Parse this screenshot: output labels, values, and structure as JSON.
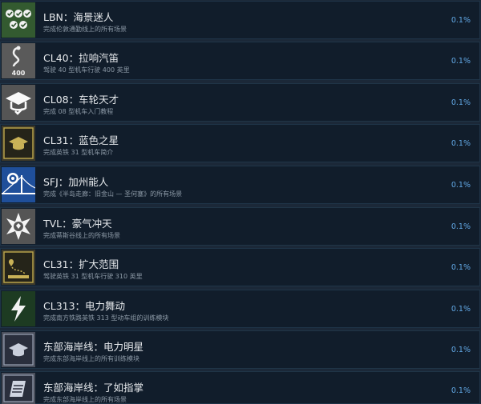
{
  "achievements": [
    {
      "icon": "checklist-badges-icon",
      "title": "LBN：海景迷人",
      "description": "完成伦敦通勤线上的所有场景",
      "percent": "0.1%"
    },
    {
      "icon": "route-400-icon",
      "title": "CL40：拉响汽笛",
      "description": "驾驶 40 型机车行驶 400 英里",
      "percent": "0.1%"
    },
    {
      "icon": "graduation-cap-icon",
      "title": "CL08：车轮天才",
      "description": "完成 08 型机车入门教程",
      "percent": "0.1%"
    },
    {
      "icon": "gold-mortarboard-icon",
      "title": "CL31：蓝色之星",
      "description": "完成英铁 31 型机车简介",
      "percent": "0.1%"
    },
    {
      "icon": "golden-gate-bridge-icon",
      "title": "SFJ：加州能人",
      "description": "完成《半岛走廊：旧金山 — 圣何塞》的所有场景",
      "percent": "0.1%"
    },
    {
      "icon": "star-emblem-icon",
      "title": "TVL：豪气冲天",
      "description": "完成蒂斯谷线上的所有场景",
      "percent": "0.1%"
    },
    {
      "icon": "gold-route-map-icon",
      "title": "CL31：扩大范围",
      "description": "驾驶英铁 31 型机车行驶 310 英里",
      "percent": "0.1%"
    },
    {
      "icon": "lightning-bolt-icon",
      "title": "CL313：电力舞动",
      "description": "完成南方铁路英铁 313 型动车组的训练模块",
      "percent": "0.1%"
    },
    {
      "icon": "dark-mortarboard-icon",
      "title": "东部海岸线：电力明星",
      "description": "完成东部海岸线上的所有训练模块",
      "percent": "0.1%"
    },
    {
      "icon": "handbook-icon",
      "title": "东部海岸线：了如指掌",
      "description": "完成东部海岸线上的所有场景",
      "percent": "0.1%"
    }
  ]
}
